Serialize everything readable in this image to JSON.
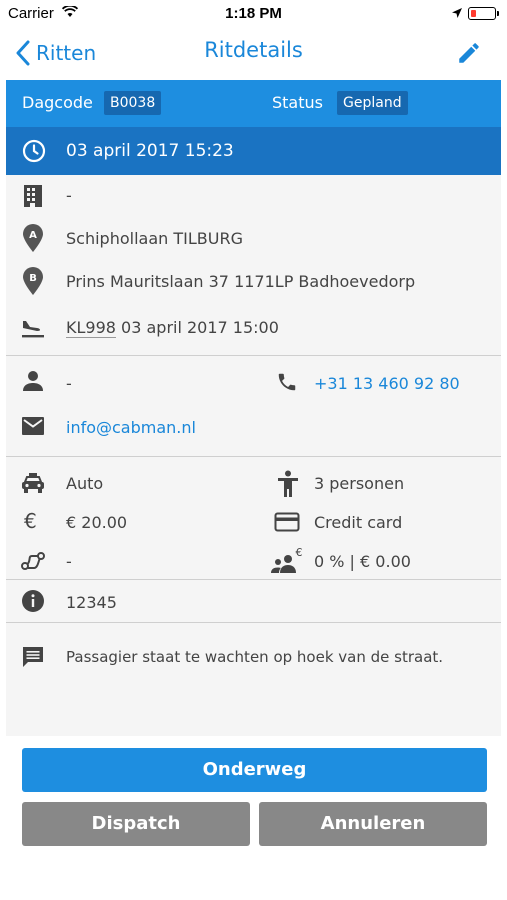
{
  "status_bar": {
    "carrier": "Carrier",
    "time": "1:18 PM"
  },
  "nav": {
    "back_label": "Ritten",
    "title": "Ritdetails"
  },
  "header": {
    "dagcode_label": "Dagcode",
    "dagcode_value": "B0038",
    "status_label": "Status",
    "status_value": "Gepland"
  },
  "datetime": "03 april 2017  15:23",
  "route": {
    "company": "-",
    "pickup": "Schiphollaan TILBURG",
    "dropoff": "Prins Mauritslaan 37 1171LP Badhoevedorp",
    "flight_code": "KL998",
    "flight_time": " 03 april 2017  15:00"
  },
  "contact": {
    "name": "-",
    "phone": "+31 13 460 92 80",
    "email": "info@cabman.nl"
  },
  "ride": {
    "vehicle": "Auto",
    "persons": "3 personen",
    "price": "€ 20.00",
    "payment": "Credit card",
    "route_info": "-",
    "commission": "0 % | € 0.00"
  },
  "info_number": "12345",
  "comment": "Passagier staat te wachten op hoek van de straat.",
  "buttons": {
    "primary": "Onderweg",
    "dispatch": "Dispatch",
    "cancel": "Annuleren"
  },
  "colors": {
    "accent": "#1e8ee0",
    "header_dark": "#1a73c2",
    "chip": "#1668b0",
    "grey_button": "#888888"
  }
}
